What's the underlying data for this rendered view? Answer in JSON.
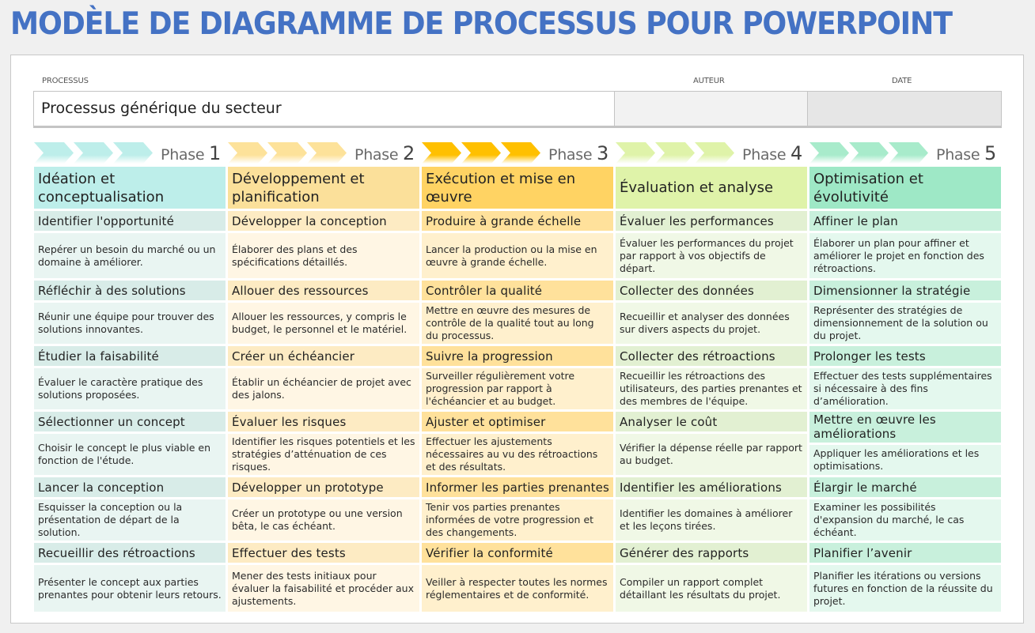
{
  "title": "MODÈLE DE DIAGRAMME DE PROCESSUS POUR POWERPOINT",
  "header": {
    "process_label": "PROCESSUS",
    "process_value": "Processus générique du secteur",
    "author_label": "AUTEUR",
    "author_value": "",
    "date_label": "DATE",
    "date_value": ""
  },
  "colors": {
    "title": "#4472c4",
    "phase1": "#bdeeea",
    "phase2": "#fbe09a",
    "phase3": "#ffc000",
    "phase4": "#dff3a9",
    "phase5": "#9ee8c6"
  },
  "phases": [
    {
      "label": "Phase",
      "number": "1",
      "title": "Idéation et conceptualisation",
      "chevron_color": "#bdeeea",
      "steps": [
        {
          "task": "Identifier l'opportunité",
          "desc": "Repérer un besoin du marché ou un domaine à améliorer."
        },
        {
          "task": "Réfléchir à des solutions",
          "desc": "Réunir une équipe pour trouver des solutions innovantes."
        },
        {
          "task": "Étudier la faisabilité",
          "desc": "Évaluer le caractère pratique des solutions proposées."
        },
        {
          "task": "Sélectionner un concept",
          "desc": "Choisir le concept le plus viable en fonction de l'étude."
        },
        {
          "task": "Lancer la conception",
          "desc": "Esquisser la conception ou la présentation de départ de la solution."
        },
        {
          "task": "Recueillir des rétroactions",
          "desc": "Présenter le concept aux parties prenantes pour obtenir leurs retours."
        }
      ]
    },
    {
      "label": "Phase",
      "number": "2",
      "title": "Développement et planification",
      "chevron_color": "#fde29a",
      "steps": [
        {
          "task": "Développer la conception",
          "desc": "Élaborer des plans et des spécifications détaillés."
        },
        {
          "task": "Allouer des ressources",
          "desc": "Allouer les ressources, y compris le budget, le personnel et le matériel."
        },
        {
          "task": "Créer un échéancier",
          "desc": "Établir un échéancier de projet avec des jalons."
        },
        {
          "task": "Évaluer les risques",
          "desc": "Identifier les risques potentiels et les stratégies d’atténuation de ces risques."
        },
        {
          "task": "Développer un prototype",
          "desc": "Créer un prototype ou une version bêta, le cas échéant."
        },
        {
          "task": "Effectuer des tests",
          "desc": "Mener des tests initiaux pour évaluer la faisabilité et procéder aux ajustements."
        }
      ]
    },
    {
      "label": "Phase",
      "number": "3",
      "title": "Exécution et mise en œuvre",
      "chevron_color": "#ffc000",
      "steps": [
        {
          "task": "Produire à grande échelle",
          "desc": "Lancer la production ou la mise en œuvre à grande échelle."
        },
        {
          "task": "Contrôler la qualité",
          "desc": "Mettre en œuvre des mesures de contrôle de la qualité tout au long du processus."
        },
        {
          "task": "Suivre la progression",
          "desc": "Surveiller régulièrement votre progression par rapport à l'échéancier et au budget."
        },
        {
          "task": "Ajuster et optimiser",
          "desc": "Effectuer les ajustements nécessaires au vu des rétroactions et des résultats."
        },
        {
          "task": "Informer les parties prenantes",
          "desc": "Tenir vos parties prenantes informées de votre progression et des changements."
        },
        {
          "task": "Vérifier la conformité",
          "desc": "Veiller à respecter toutes les normes réglementaires et de conformité."
        }
      ]
    },
    {
      "label": "Phase",
      "number": "4",
      "title": "Évaluation et analyse",
      "chevron_color": "#dff3a9",
      "steps": [
        {
          "task": "Évaluer les performances",
          "desc": "Évaluer les performances du projet par rapport à vos objectifs de départ."
        },
        {
          "task": "Collecter des données",
          "desc": "Recueillir et analyser des données sur divers aspects du projet."
        },
        {
          "task": "Collecter des rétroactions",
          "desc": "Recueillir les rétroactions des utilisateurs, des parties prenantes et des membres de l'équipe."
        },
        {
          "task": "Analyser le coût",
          "desc": "Vérifier la dépense réelle par rapport au budget."
        },
        {
          "task": "Identifier les améliorations",
          "desc": "Identifier les domaines à améliorer et les leçons tirées."
        },
        {
          "task": "Générer des rapports",
          "desc": "Compiler un rapport complet détaillant les résultats du projet."
        }
      ]
    },
    {
      "label": "Phase",
      "number": "5",
      "title": "Optimisation et évolutivité",
      "chevron_color": "#a8ebcb",
      "steps": [
        {
          "task": "Affiner le plan",
          "desc": "Élaborer un plan pour affiner et améliorer le projet en fonction des rétroactions."
        },
        {
          "task": "Dimensionner la stratégie",
          "desc": "Représenter des stratégies de dimensionnement de la solution ou du projet."
        },
        {
          "task": "Prolonger les tests",
          "desc": "Effectuer des tests supplémentaires si nécessaire à des fins d’amélioration."
        },
        {
          "task": "Mettre en œuvre les améliorations",
          "desc": "Appliquer les améliorations et les optimisations."
        },
        {
          "task": "Élargir le marché",
          "desc": "Examiner les possibilités d'expansion du marché, le cas échéant."
        },
        {
          "task": "Planifier l’avenir",
          "desc": "Planifier les itérations ou versions futures en fonction de la réussite du projet."
        }
      ]
    }
  ]
}
